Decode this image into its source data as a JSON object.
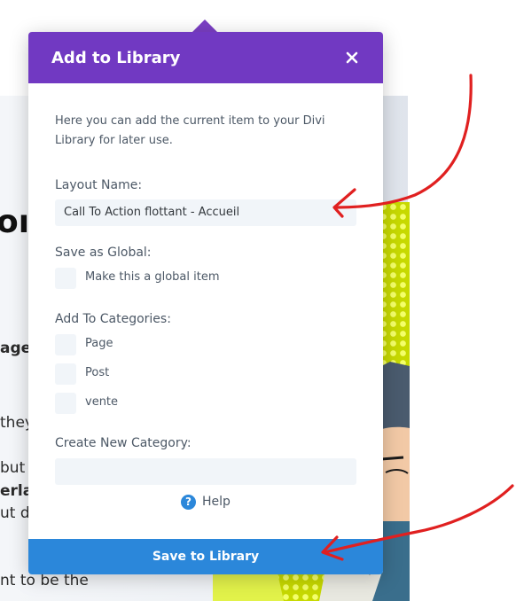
{
  "background": {
    "heading_fragment": "oı",
    "text_lines": [
      {
        "text": "age",
        "bold": true
      },
      {
        "text": "they",
        "bold": false
      },
      {
        "text": " but",
        "bold": false
      },
      {
        "text": "erla",
        "bold": true
      },
      {
        "text": "ut do",
        "bold": false
      },
      {
        "text": "nt to be the",
        "bold": false
      }
    ]
  },
  "modal": {
    "title": "Add to Library",
    "description": "Here you can add the current item to your Divi Library for later use.",
    "layout_name": {
      "label": "Layout Name:",
      "value": "Call To Action flottant - Accueil"
    },
    "save_as_global": {
      "label": "Save as Global:",
      "option": "Make this a global item"
    },
    "categories": {
      "label": "Add To Categories:",
      "items": [
        "Page",
        "Post",
        "vente"
      ]
    },
    "new_category": {
      "label": "Create New Category:",
      "value": ""
    },
    "help_label": "Help",
    "help_icon": "?",
    "save_button": "Save to Library"
  },
  "colors": {
    "header": "#7139c2",
    "save_button": "#2b87da",
    "annotation": "#e02020"
  }
}
